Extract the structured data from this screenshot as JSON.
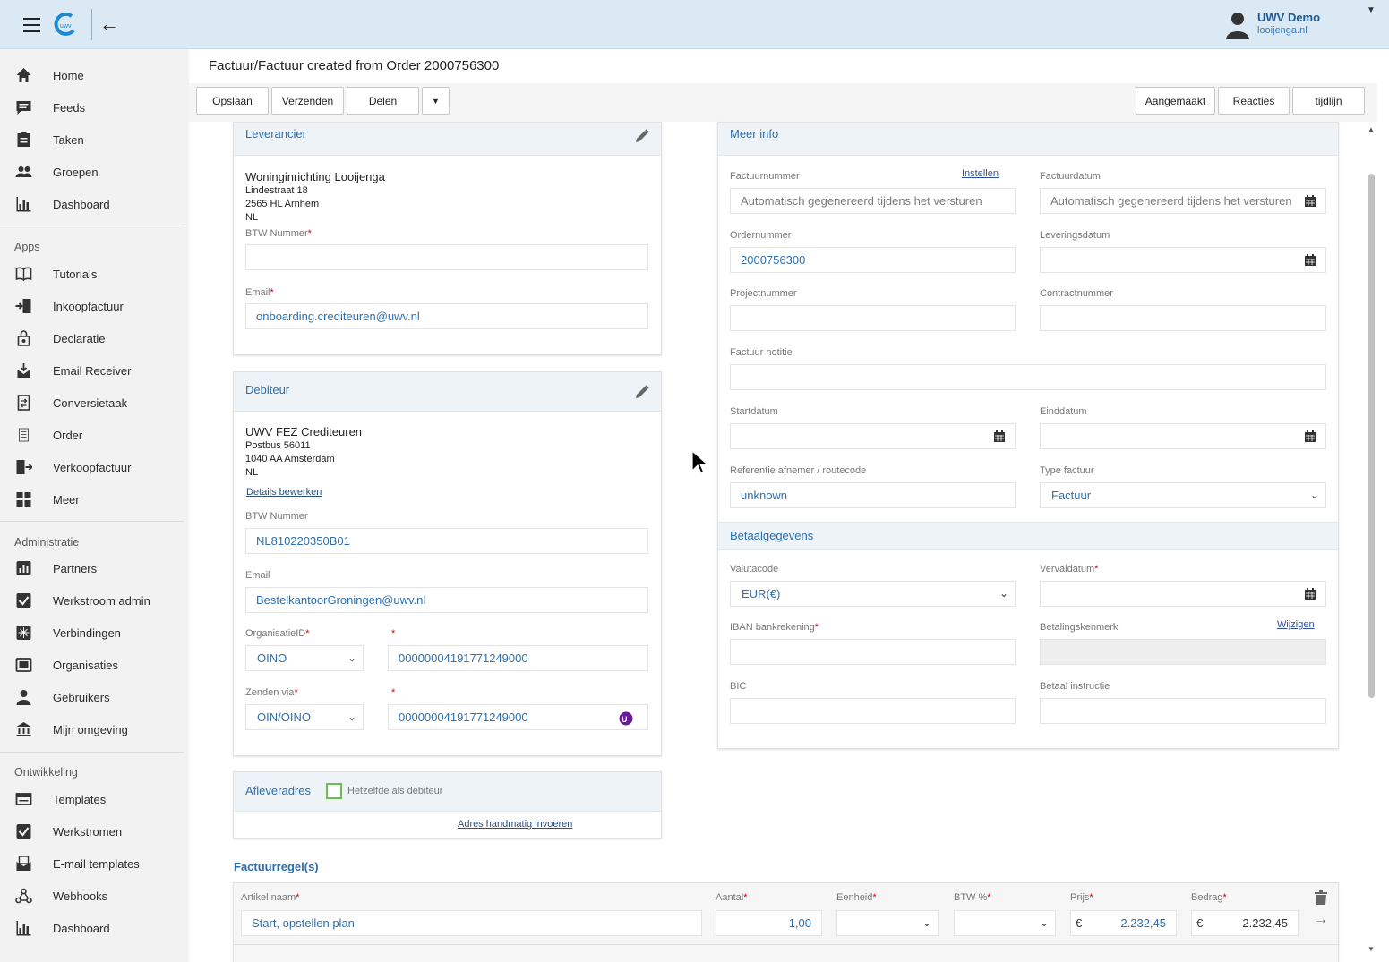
{
  "header": {
    "user_name": "UWV Demo",
    "user_domain": "looijenga.nl"
  },
  "sidebar": {
    "main": [
      {
        "label": "Home",
        "icon": "home-icon"
      },
      {
        "label": "Feeds",
        "icon": "feeds-icon"
      },
      {
        "label": "Taken",
        "icon": "tasks-icon"
      },
      {
        "label": "Groepen",
        "icon": "groups-icon"
      },
      {
        "label": "Dashboard",
        "icon": "dashboard-icon"
      }
    ],
    "apps_title": "Apps",
    "apps": [
      {
        "label": "Tutorials",
        "icon": "book-icon"
      },
      {
        "label": "Inkoopfactuur",
        "icon": "purchase-invoice-icon"
      },
      {
        "label": "Declaratie",
        "icon": "declaration-icon"
      },
      {
        "label": "Email Receiver",
        "icon": "email-receiver-icon"
      },
      {
        "label": "Conversietaak",
        "icon": "conversion-icon"
      },
      {
        "label": "Order",
        "icon": "order-icon"
      },
      {
        "label": "Verkoopfactuur",
        "icon": "sales-invoice-icon"
      },
      {
        "label": "Meer",
        "icon": "more-grid-icon"
      }
    ],
    "admin_title": "Administratie",
    "admin": [
      {
        "label": "Partners",
        "icon": "partners-icon"
      },
      {
        "label": "Werkstroom admin",
        "icon": "workflow-admin-icon"
      },
      {
        "label": "Verbindingen",
        "icon": "connections-icon"
      },
      {
        "label": "Organisaties",
        "icon": "organisations-icon"
      },
      {
        "label": "Gebruikers",
        "icon": "users-icon"
      },
      {
        "label": "Mijn omgeving",
        "icon": "environment-icon"
      }
    ],
    "dev_title": "Ontwikkeling",
    "dev": [
      {
        "label": "Templates",
        "icon": "templates-icon"
      },
      {
        "label": "Werkstromen",
        "icon": "workflows-icon"
      },
      {
        "label": "E-mail templates",
        "icon": "email-templates-icon"
      },
      {
        "label": "Webhooks",
        "icon": "webhooks-icon"
      },
      {
        "label": "Dashboard",
        "icon": "dashboard-icon"
      }
    ]
  },
  "page": {
    "title": "Factuur/Factuur created from Order 2000756300"
  },
  "toolbar": {
    "save": "Opslaan",
    "send": "Verzenden",
    "share": "Delen",
    "created": "Aangemaakt",
    "reactions": "Reacties",
    "timeline": "tijdlijn"
  },
  "leverancier": {
    "title": "Leverancier",
    "name": "Woninginrichting Looijenga",
    "street": "Lindestraat 18",
    "city": "2565 HL Arnhem",
    "country": "NL",
    "btw_label": "BTW Nummer",
    "btw_value": "",
    "email_label": "Email",
    "email_value": "onboarding.crediteuren@uwv.nl"
  },
  "debiteur": {
    "title": "Debiteur",
    "name": "UWV FEZ Crediteuren",
    "street": "Postbus 56011",
    "city": "1040 AA Amsterdam",
    "country": "NL",
    "details_link": "Details bewerken",
    "btw_label": "BTW Nummer",
    "btw_value": "NL810220350B01",
    "email_label": "Email",
    "email_value": "BestelkantoorGroningen@uwv.nl",
    "org_label": "OrganisatieID",
    "org_type": "OINO",
    "org_value": "00000004191771249000",
    "send_label": "Zenden via",
    "send_type": "OIN/OINO",
    "send_value": "00000004191771249000"
  },
  "afleveradres": {
    "title": "Afleveradres",
    "same_label": "Hetzelfde als debiteur",
    "manual_link": "Adres handmatig invoeren"
  },
  "meer_info": {
    "title": "Meer info",
    "factuurnummer_label": "Factuurnummer",
    "instellen_link": "Instellen",
    "factuurnummer_placeholder": "Automatisch gegenereerd tijdens het versturen",
    "factuurdatum_label": "Factuurdatum",
    "factuurdatum_placeholder": "Automatisch gegenereerd tijdens het versturen",
    "ordernummer_label": "Ordernummer",
    "ordernummer_value": "2000756300",
    "leveringsdatum_label": "Leveringsdatum",
    "leveringsdatum_value": "",
    "projectnummer_label": "Projectnummer",
    "projectnummer_value": "",
    "contractnummer_label": "Contractnummer",
    "contractnummer_value": "",
    "notitie_label": "Factuur notitie",
    "notitie_value": "",
    "startdatum_label": "Startdatum",
    "startdatum_value": "",
    "einddatum_label": "Einddatum",
    "einddatum_value": "",
    "referentie_label": "Referentie afnemer / routecode",
    "referentie_value": "unknown",
    "type_label": "Type factuur",
    "type_value": "Factuur"
  },
  "betaal": {
    "title": "Betaalgegevens",
    "valuta_label": "Valutacode",
    "valuta_value": "EUR(€)",
    "verval_label": "Vervaldatum",
    "verval_value": "",
    "iban_label": "IBAN bankrekening",
    "iban_value": "",
    "kenmerk_label": "Betalingskenmerk",
    "wijzigen_link": "Wijzigen",
    "kenmerk_value": "",
    "bic_label": "BIC",
    "bic_value": "",
    "instructie_label": "Betaal instructie",
    "instructie_value": ""
  },
  "regels": {
    "title": "Factuurregel(s)",
    "headers": {
      "artikel": "Artikel naam",
      "aantal": "Aantal",
      "eenheid": "Eenheid",
      "btw": "BTW %",
      "prijs": "Prijs",
      "bedrag": "Bedrag"
    },
    "rows": [
      {
        "artikel": "Start, opstellen plan",
        "aantal": "1,00",
        "eenheid": "",
        "btw": "",
        "prijs_cur": "€",
        "prijs": "2.232,45",
        "bedrag_cur": "€",
        "bedrag": "2.232,45"
      }
    ]
  }
}
